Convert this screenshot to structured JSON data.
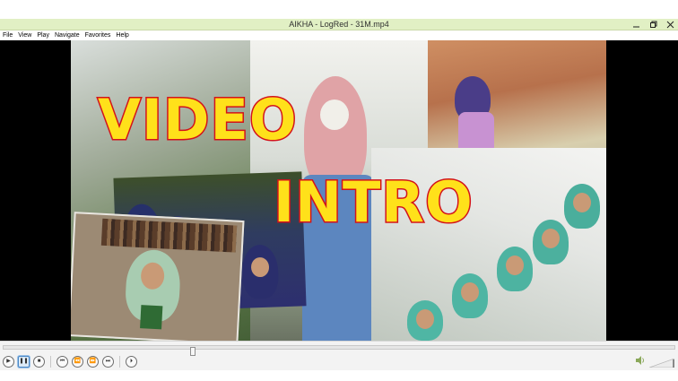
{
  "window": {
    "title": "AIKHA - LogRed - 31M.mp4",
    "minimize_icon": "minimize-icon",
    "maximize_icon": "maximize-icon",
    "close_icon": "close-icon"
  },
  "menu": {
    "items": [
      {
        "label": "File",
        "key": "F"
      },
      {
        "label": "View",
        "key": "V"
      },
      {
        "label": "Play",
        "key": "P"
      },
      {
        "label": "Navigate",
        "key": "N"
      },
      {
        "label": "Favorites",
        "key": "a"
      },
      {
        "label": "Help",
        "key": "H"
      }
    ]
  },
  "video": {
    "overlay_line1": "VIDEO",
    "overlay_line2": "INTRO"
  },
  "playback": {
    "seek_position_fraction": 0.28,
    "volume_fraction": 0.0,
    "buttons": [
      {
        "name": "play-button",
        "icon": "play-icon",
        "glyph": "▶"
      },
      {
        "name": "pause-button",
        "icon": "pause-icon",
        "glyph": "❚❚",
        "active": true
      },
      {
        "name": "stop-button",
        "icon": "stop-icon",
        "glyph": "■"
      },
      {
        "name": "previous-button",
        "icon": "skip-back-icon",
        "glyph": "⏮"
      },
      {
        "name": "rewind-button",
        "icon": "rewind-icon",
        "glyph": "⏪"
      },
      {
        "name": "forward-button",
        "icon": "fast-forward-icon",
        "glyph": "⏩"
      },
      {
        "name": "next-button",
        "icon": "skip-forward-icon",
        "glyph": "⏭"
      },
      {
        "name": "frame-step-button",
        "icon": "frame-step-icon",
        "glyph": "⏵"
      }
    ],
    "volume_icon": "speaker-icon"
  },
  "colors": {
    "titlebar": "#e1f0c4",
    "overlay_text_fill": "#ffe11a",
    "overlay_text_stroke": "#d3121a"
  }
}
